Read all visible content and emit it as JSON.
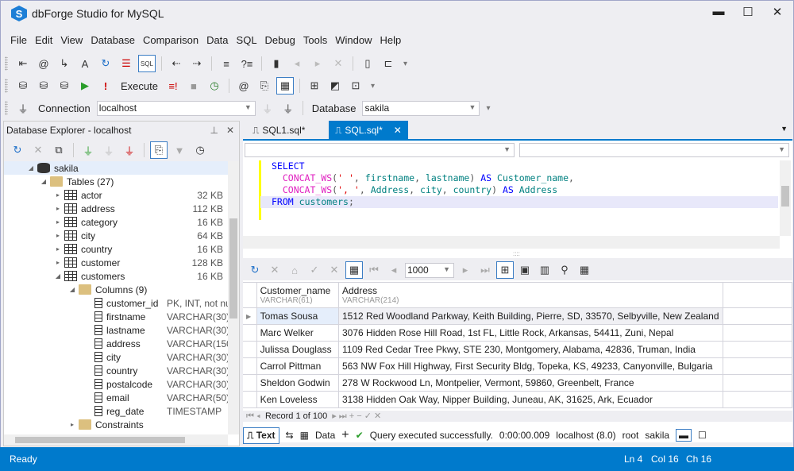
{
  "app": {
    "title": "dbForge Studio for MySQL",
    "logo": "S"
  },
  "window_controls": {
    "minimize": "▬",
    "maximize": "☐",
    "close": "✕"
  },
  "menu": [
    "File",
    "Edit",
    "View",
    "Database",
    "Comparison",
    "Data",
    "SQL",
    "Debug",
    "Tools",
    "Window",
    "Help"
  ],
  "toolbar2": {
    "execute_label": "Execute"
  },
  "toolbar3": {
    "connection_label": "Connection",
    "connection_value": "localhost",
    "database_label": "Database",
    "database_value": "sakila"
  },
  "explorer": {
    "title": "Database Explorer - localhost",
    "db": "sakila",
    "tables_label": "Tables (27)",
    "tables": [
      {
        "name": "actor",
        "size": "32 KB"
      },
      {
        "name": "address",
        "size": "112 KB"
      },
      {
        "name": "category",
        "size": "16 KB"
      },
      {
        "name": "city",
        "size": "64 KB"
      },
      {
        "name": "country",
        "size": "16 KB"
      },
      {
        "name": "customer",
        "size": "128 KB"
      },
      {
        "name": "customers",
        "size": "16 KB"
      }
    ],
    "columns_label": "Columns (9)",
    "columns": [
      {
        "name": "customer_id",
        "type": "PK, INT, not nu"
      },
      {
        "name": "firstname",
        "type": "VARCHAR(30),"
      },
      {
        "name": "lastname",
        "type": "VARCHAR(30),"
      },
      {
        "name": "address",
        "type": "VARCHAR(150)"
      },
      {
        "name": "city",
        "type": "VARCHAR(30),"
      },
      {
        "name": "country",
        "type": "VARCHAR(30),"
      },
      {
        "name": "postalcode",
        "type": "VARCHAR(30),"
      },
      {
        "name": "email",
        "type": "VARCHAR(50)"
      },
      {
        "name": "reg_date",
        "type": "TIMESTAMP"
      }
    ],
    "constraints_label": "Constraints"
  },
  "tabs": [
    {
      "label": "SQL1.sql*"
    },
    {
      "label": "SQL.sql*",
      "active": true
    }
  ],
  "editor": {
    "lines": [
      "SELECT",
      "  CONCAT_WS(' ', firstname, lastname) AS Customer_name,",
      "  CONCAT_WS(', ', Address, city, country) AS Address",
      "FROM customers;"
    ]
  },
  "results": {
    "page_size": "1000",
    "columns": [
      {
        "name": "Customer_name",
        "type": "VARCHAR(61)"
      },
      {
        "name": "Address",
        "type": "VARCHAR(214)"
      }
    ],
    "rows": [
      [
        "Tomas Sousa",
        "1512 Red Woodland Parkway, Keith Building, Pierre, SD, 33570, Selbyville, New Zealand"
      ],
      [
        "Marc Welker",
        "3076 Hidden Rose Hill Road, 1st FL, Little Rock, Arkansas, 54411, Zuni, Nepal"
      ],
      [
        "Julissa Douglass",
        "1109 Red Cedar Tree Pkwy, STE 230, Montgomery, Alabama, 42836, Truman, India"
      ],
      [
        "Carrol Pittman",
        "563 NW Fox Hill Highway, First Security Bldg, Topeka, KS, 49233, Canyonville, Bulgaria"
      ],
      [
        "Sheldon Godwin",
        "278 W Rockwood Ln, Montpelier, Vermont, 59860, Greenbelt, France"
      ],
      [
        "Ken Loveless",
        "3138 Hidden Oak Way, Nipper Building, Juneau, AK, 31625, Ark, Ecuador"
      ]
    ],
    "record_nav": "Record 1 of 100"
  },
  "bottom": {
    "text_tab": "Text",
    "data_tab": "Data",
    "status": "Query executed successfully.",
    "time": "0:00:00.009",
    "server": "localhost (8.0)",
    "user": "root",
    "db": "sakila"
  },
  "statusbar": {
    "left": "Ready",
    "ln": "Ln 4",
    "col": "Col 16",
    "ch": "Ch 16"
  }
}
